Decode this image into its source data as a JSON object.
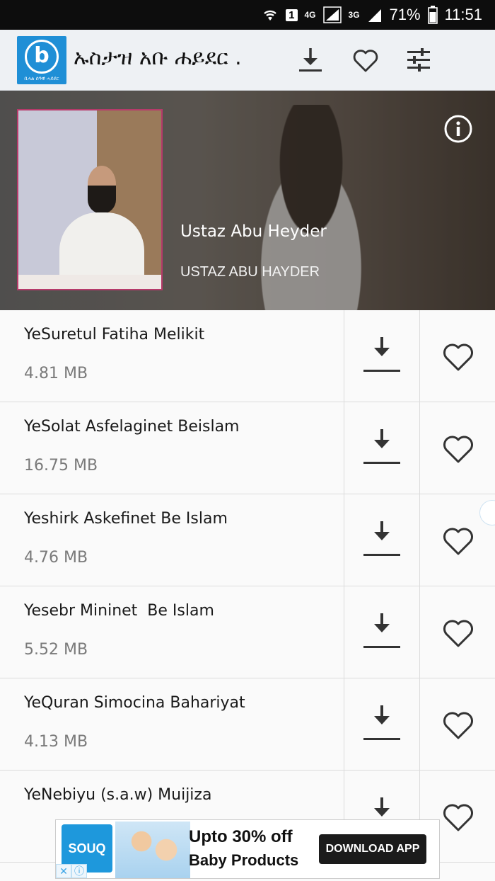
{
  "status_bar": {
    "network_a": "4G",
    "network_b": "3G",
    "sim": "1",
    "battery": "71%",
    "time": "11:51"
  },
  "app_bar": {
    "logo_text": "ቢላል ሰዓዊ ሓይደር",
    "title": "ኡስታዝ አቡ ሐይደር ."
  },
  "header": {
    "name": "Ustaz Abu Heyder",
    "subtitle": "USTAZ ABU HAYDER"
  },
  "items": [
    {
      "title": "YeSuretul Fatiha Melikit",
      "size": "4.81 MB"
    },
    {
      "title": "YeSolat Asfelaginet Beislam",
      "size": "16.75 MB"
    },
    {
      "title": "Yeshirk Askefinet Be Islam",
      "size": "4.76 MB"
    },
    {
      "title": "Yesebr Mininet  Be Islam",
      "size": "5.52 MB"
    },
    {
      "title": "YeQuran Simocina Bahariyat",
      "size": "4.13 MB"
    },
    {
      "title": "YeNebiyu (s.a.w) Muijiza",
      "size": ""
    }
  ],
  "ad": {
    "brand": "SOUQ",
    "headline": "Upto 30% off",
    "subline": "Baby Products",
    "cta": "DOWNLOAD APP"
  },
  "colors": {
    "status_bar": "#0d0d0d",
    "app_bar": "#eef1f4",
    "logo": "#1f8fd6",
    "icon": "#333333",
    "ad_brand": "#1e98dc"
  },
  "icons": {
    "download": "download-icon",
    "favorite": "heart-icon",
    "settings": "sliders-icon",
    "info": "info-icon"
  }
}
